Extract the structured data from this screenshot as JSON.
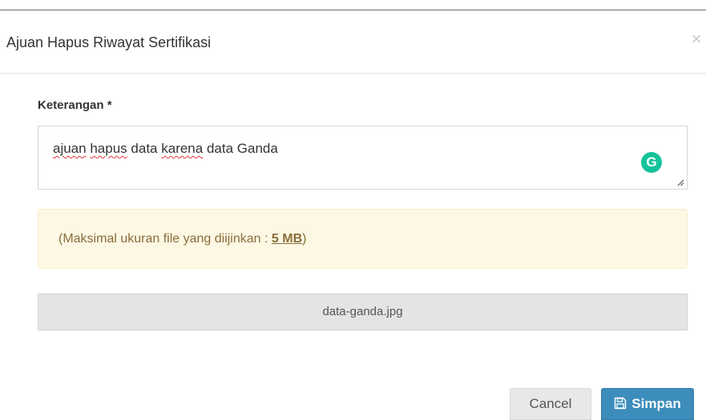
{
  "modal": {
    "title": "Ajuan Hapus Riwayat Sertifikasi",
    "close_glyph": "×"
  },
  "form": {
    "label": "Keterangan *",
    "textarea_words": [
      "ajuan",
      "hapus",
      "data",
      "karena",
      "data Ganda"
    ],
    "grammarly_glyph": "G",
    "alert_prefix": "(Maksimal ukuran file yang diijinkan : ",
    "alert_size": "5 MB",
    "alert_suffix": ")",
    "file_name": "data-ganda.jpg"
  },
  "buttons": {
    "cancel_label": "Cancel",
    "save_label": "Simpan"
  },
  "icons": {
    "close": "close-icon",
    "grammarly": "grammarly-icon",
    "save": "floppy-disk-icon",
    "resize": "resize-handle-icon"
  },
  "colors": {
    "primary": "#3c8dbc",
    "warning_bg": "#fcf8e3",
    "warning_text": "#8a6d3b",
    "grammarly": "#15c39a",
    "spellcheck": "#e0363e"
  }
}
